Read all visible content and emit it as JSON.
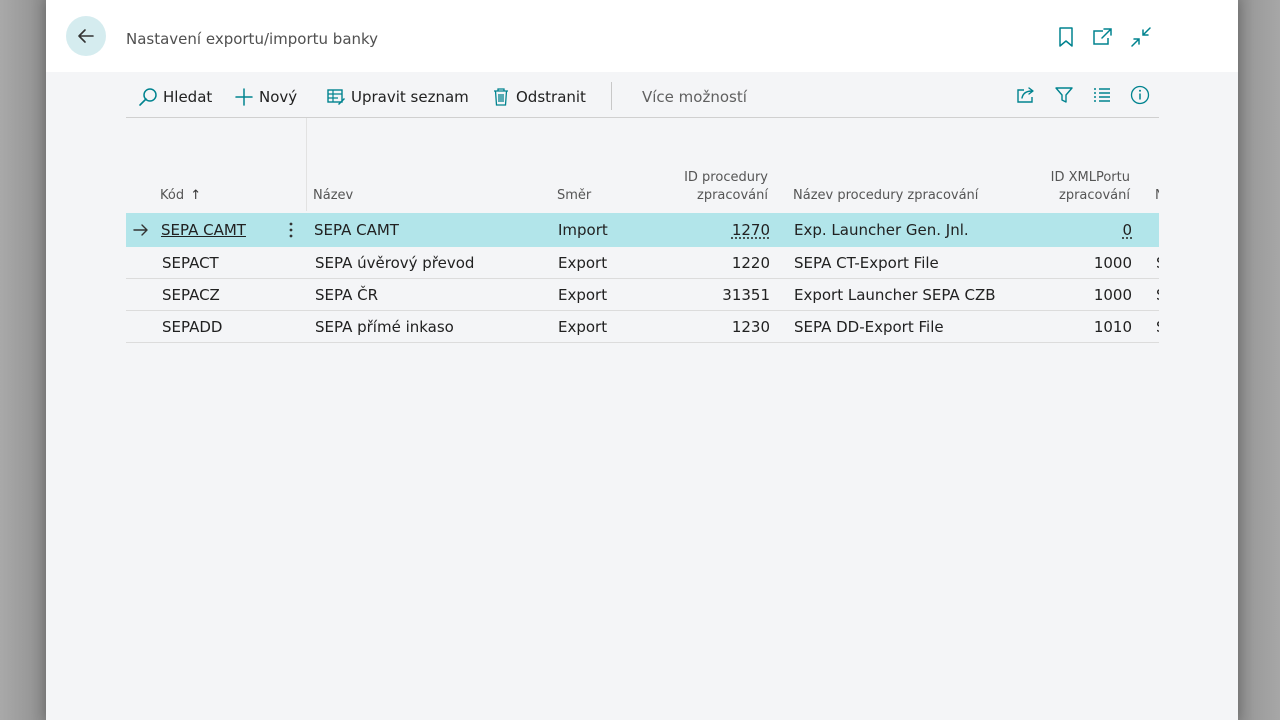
{
  "page": {
    "title": "Nastavení exportu/importu banky"
  },
  "header_icons": [
    {
      "name": "bookmark-icon"
    },
    {
      "name": "open-in-new-window-icon"
    },
    {
      "name": "collapse-icon"
    }
  ],
  "toolbar": {
    "search_label": "Hledat",
    "new_label": "Nový",
    "edit_list_label": "Upravit seznam",
    "delete_label": "Odstranit",
    "more_label": "Více možností"
  },
  "table": {
    "columns": {
      "code": "Kód",
      "code_sort": "↑",
      "name": "Název",
      "direction": "Směr",
      "proc_id_line1": "ID procedury",
      "proc_id_line2": "zpracování",
      "proc_name": "Název procedury zpracování",
      "xml_id_line1": "ID XMLPortu",
      "xml_id_line2": "zpracování",
      "next_col": "N"
    },
    "rows": [
      {
        "code": "SEPA CAMT",
        "name": "SEPA CAMT",
        "direction": "Import",
        "proc_id": "1270",
        "proc_name": "Exp. Launcher Gen. Jnl.",
        "xml_id": "0",
        "next": "S"
      },
      {
        "code": "SEPACT",
        "name": "SEPA úvěrový převod",
        "direction": "Export",
        "proc_id": "1220",
        "proc_name": "SEPA CT-Export File",
        "xml_id": "1000",
        "next": "S"
      },
      {
        "code": "SEPACZ",
        "name": "SEPA ČR",
        "direction": "Export",
        "proc_id": "31351",
        "proc_name": "Export Launcher SEPA CZB",
        "xml_id": "1000",
        "next": "S"
      },
      {
        "code": "SEPADD",
        "name": "SEPA přímé inkaso",
        "direction": "Export",
        "proc_id": "1230",
        "proc_name": "SEPA DD-Export File",
        "xml_id": "1010",
        "next": "S"
      }
    ]
  },
  "colors": {
    "accent": "#00838f",
    "selected_row": "#b2e5ea",
    "back_button_bg": "#d5ecef"
  }
}
